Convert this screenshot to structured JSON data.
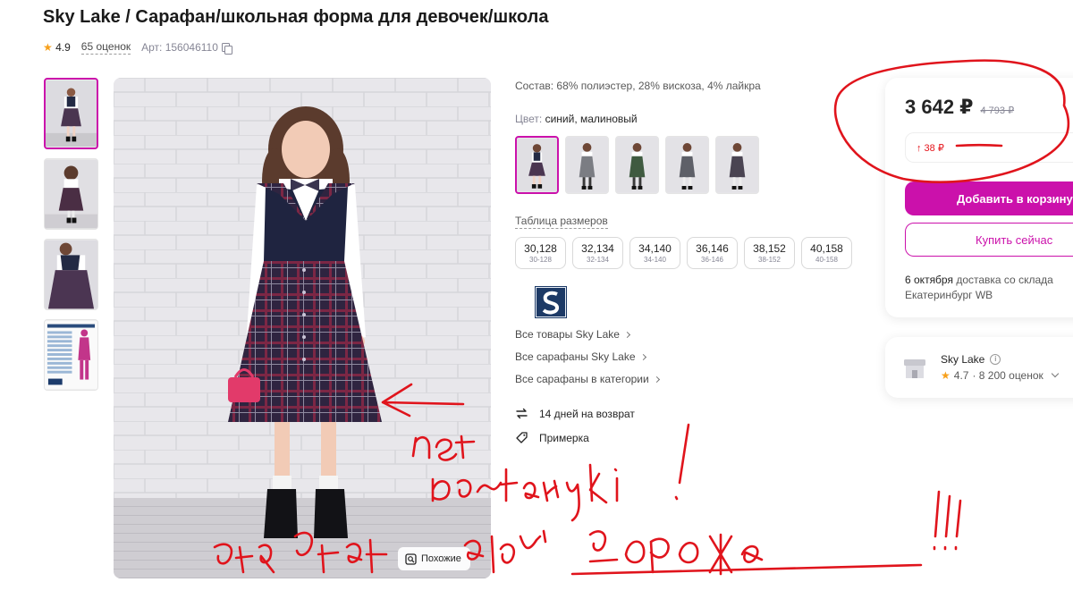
{
  "product": {
    "title": "Sky Lake / Сарафан/школьная форма для девочек/школа",
    "rating": "4.9",
    "reviews": "65 оценок",
    "article": "Арт: 156046110"
  },
  "main_image": {
    "similar_label": "Похожие"
  },
  "details": {
    "composition": "Состав: 68% полиэстер, 28% вискоза, 4% лайкра",
    "color_label": "Цвет:",
    "color_value": "синий, малиновый",
    "size_table_label": "Таблица размеров",
    "sizes": [
      {
        "ru": "30,128",
        "eu": "30-128"
      },
      {
        "ru": "32,134",
        "eu": "32-134"
      },
      {
        "ru": "34,140",
        "eu": "34-140"
      },
      {
        "ru": "36,146",
        "eu": "36-146"
      },
      {
        "ru": "38,152",
        "eu": "38-152"
      },
      {
        "ru": "40,158",
        "eu": "40-158"
      }
    ],
    "links": [
      "Все товары Sky Lake",
      "Все сарафаны Sky Lake",
      "Все сарафаны в категории"
    ],
    "features": [
      "14 дней на возврат",
      "Примерка"
    ]
  },
  "price_card": {
    "price": "3 642 ₽",
    "old_price": "4 793 ₽",
    "price_change": "↑ 38 ₽",
    "add_to_cart": "Добавить в корзину",
    "buy_now": "Купить сейчас",
    "delivery_date": "6 октября",
    "delivery_text": " доставка со склада Екатеринбург WB"
  },
  "seller": {
    "name": "Sky Lake",
    "rating": "4.7",
    "reviews": "· 8 200 оценок"
  },
  "colors": {
    "accent": "#cb11ab",
    "price_up": "#e5141b",
    "annotation": "#e0141c"
  }
}
